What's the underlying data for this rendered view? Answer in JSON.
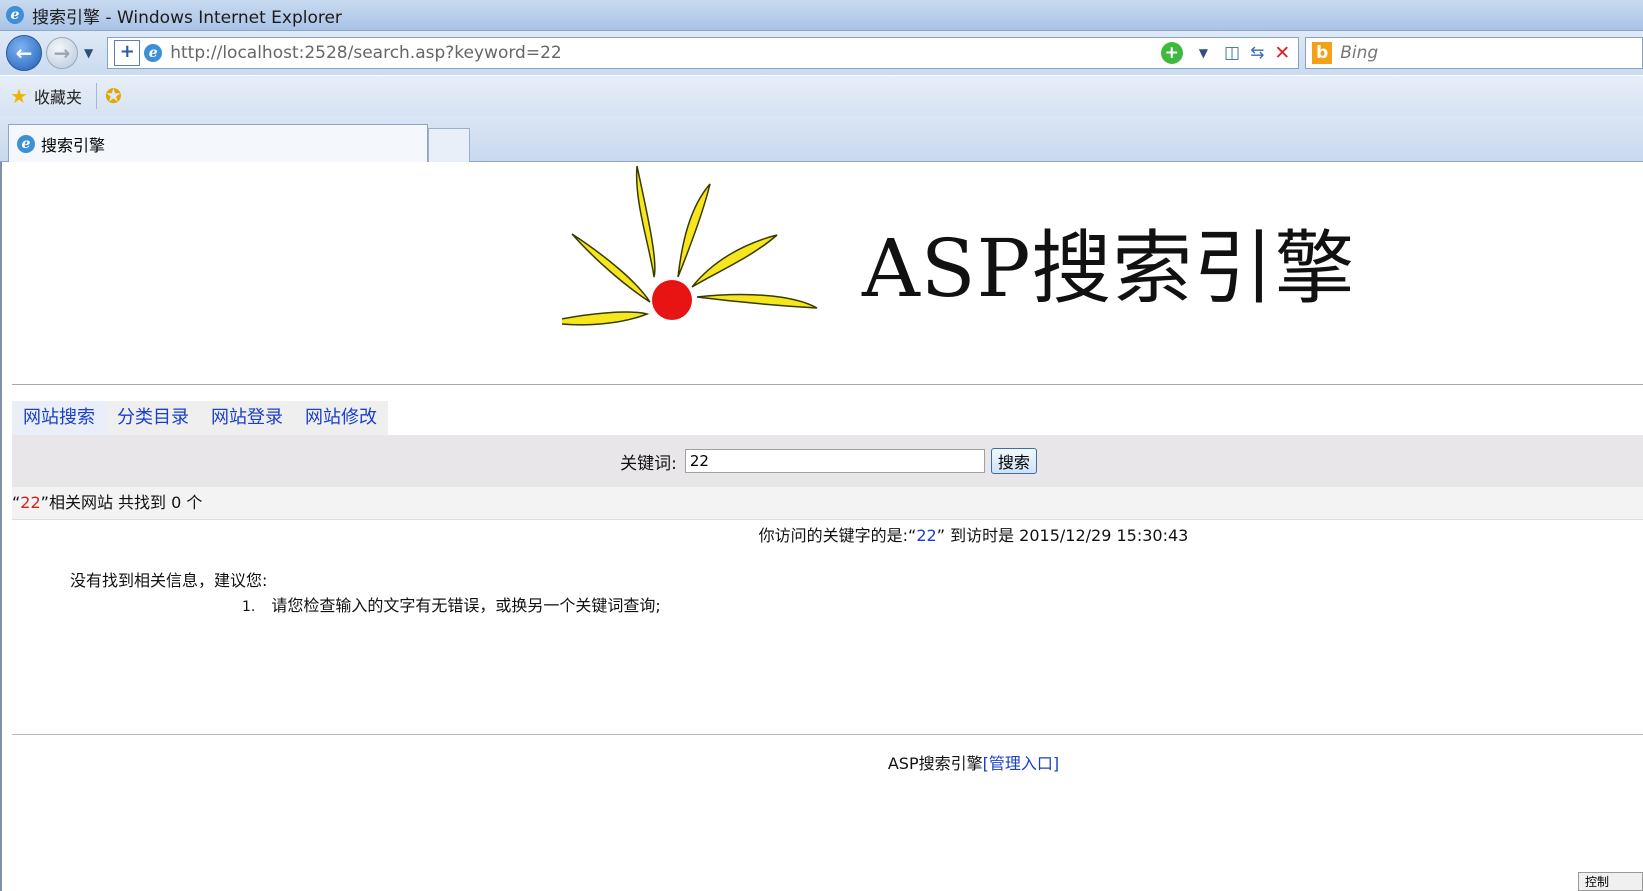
{
  "window": {
    "title": "搜索引擎 - Windows Internet Explorer"
  },
  "address": {
    "url": "http://localhost:2528/search.asp?keyword=22",
    "search_provider": "Bing"
  },
  "favorites": {
    "label": "收藏夹"
  },
  "tab": {
    "title": "搜索引擎"
  },
  "logo": {
    "text": "ASP搜索引擎"
  },
  "nav_tabs": [
    "网站搜索",
    "分类目录",
    "网站登录",
    "网站修改"
  ],
  "search": {
    "label": "关键词:",
    "value": "22",
    "button": "搜索"
  },
  "result": {
    "open_quote": "“",
    "keyword": "22",
    "summary": "”相关网站 共找到 0 个"
  },
  "visit": {
    "prefix": "你访问的关键字的是:“",
    "keyword": "22",
    "suffix": "” 到访时是 2015/12/29 15:30:43"
  },
  "tips": {
    "heading": "没有找到相关信息，建议您:",
    "item1_num": "1.",
    "item1": "请您检查输入的文字有无错误，或换另一个关键词查询;"
  },
  "footer": {
    "text": "ASP搜索引擎",
    "admin_link": "[管理入口]"
  },
  "corner": {
    "label": "控制"
  },
  "colors": {
    "link": "#1a3fc8",
    "keyword_red": "#d81c1c",
    "sun_red": "#e81414",
    "petal_yellow": "#f5e61e"
  }
}
